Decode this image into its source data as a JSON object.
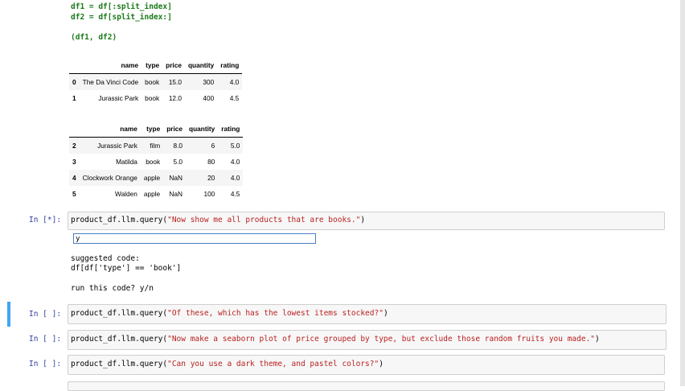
{
  "top_code": {
    "line1": "df1 = df[:split_index]",
    "line2": "df2 = df[split_index:]",
    "line3": "(df1, df2)"
  },
  "table1": {
    "headers": [
      "",
      "name",
      "type",
      "price",
      "quantity",
      "rating"
    ],
    "rows": [
      [
        "0",
        "The Da Vinci Code",
        "book",
        "15.0",
        "300",
        "4.0"
      ],
      [
        "1",
        "Jurassic Park",
        "book",
        "12.0",
        "400",
        "4.5"
      ]
    ]
  },
  "table2": {
    "headers": [
      "",
      "name",
      "type",
      "price",
      "quantity",
      "rating"
    ],
    "rows": [
      [
        "2",
        "Jurassic Park",
        "film",
        "8.0",
        "6",
        "5.0"
      ],
      [
        "3",
        "Matilda",
        "book",
        "5.0",
        "80",
        "4.0"
      ],
      [
        "4",
        "Clockwork Orange",
        "apple",
        "NaN",
        "20",
        "4.0"
      ],
      [
        "5",
        "Walden",
        "apple",
        "NaN",
        "100",
        "4.5"
      ]
    ]
  },
  "cells": [
    {
      "prompt": "In [*]:",
      "code_prefix": "product_df.llm.query(",
      "code_str": "\"Now show me all products that are books.\"",
      "code_suffix": ")"
    },
    {
      "prompt": "In [ ]:",
      "code_prefix": "product_df.llm.query(",
      "code_str": "\"Of these, which has the lowest items stocked?\"",
      "code_suffix": ")"
    },
    {
      "prompt": "In [ ]:",
      "code_prefix": "product_df.llm.query(",
      "code_str": "\"Now make a seaborn plot of price grouped by type, but exclude those random fruits you made.\"",
      "code_suffix": ")"
    },
    {
      "prompt": "In [ ]:",
      "code_prefix": "product_df.llm.query(",
      "code_str": "\"Can you use a dark theme, and pastel colors?\"",
      "code_suffix": ")"
    }
  ],
  "output": {
    "input_value": "y",
    "suggested_label": "suggested code:",
    "suggested_code": "df[df['type'] == 'book']",
    "confirm_prompt": "run this code? y/n"
  }
}
